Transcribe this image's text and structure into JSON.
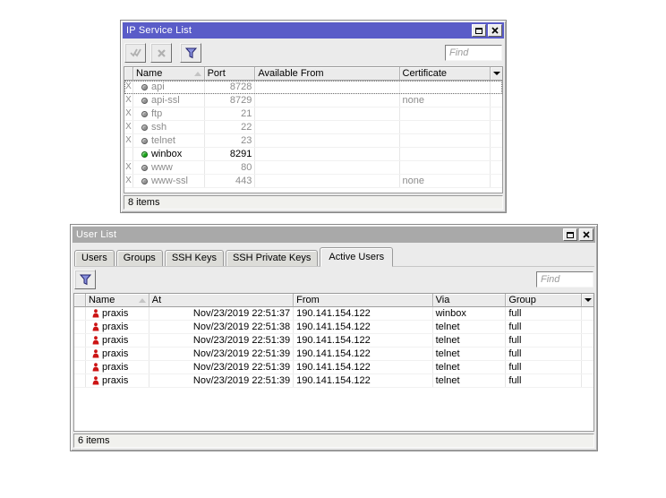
{
  "colors": {
    "active_titlebar": "#5a5cc8",
    "inactive_titlebar": "#a9a9a9",
    "enabled_dot": "#18a818",
    "disabled_dot": "#949494",
    "user_icon": "#cc1414"
  },
  "icons": {
    "disabled_mark": "X"
  },
  "windows": {
    "ip_service": {
      "title": "IP Service List",
      "find_placeholder": "Find",
      "columns": {
        "name": "Name",
        "port": "Port",
        "available_from": "Available From",
        "certificate": "Certificate"
      },
      "rows": [
        {
          "enabled": false,
          "focused": true,
          "name": "api",
          "port": "8728",
          "available_from": "",
          "certificate": ""
        },
        {
          "enabled": false,
          "focused": false,
          "name": "api-ssl",
          "port": "8729",
          "available_from": "",
          "certificate": "none"
        },
        {
          "enabled": false,
          "focused": false,
          "name": "ftp",
          "port": "21",
          "available_from": "",
          "certificate": ""
        },
        {
          "enabled": false,
          "focused": false,
          "name": "ssh",
          "port": "22",
          "available_from": "",
          "certificate": ""
        },
        {
          "enabled": false,
          "focused": false,
          "name": "telnet",
          "port": "23",
          "available_from": "",
          "certificate": ""
        },
        {
          "enabled": true,
          "focused": false,
          "name": "winbox",
          "port": "8291",
          "available_from": "",
          "certificate": ""
        },
        {
          "enabled": false,
          "focused": false,
          "name": "www",
          "port": "80",
          "available_from": "",
          "certificate": ""
        },
        {
          "enabled": false,
          "focused": false,
          "name": "www-ssl",
          "port": "443",
          "available_from": "",
          "certificate": "none"
        }
      ],
      "status": "8 items"
    },
    "user_list": {
      "title": "User List",
      "tabs": [
        {
          "label": "Users"
        },
        {
          "label": "Groups"
        },
        {
          "label": "SSH Keys"
        },
        {
          "label": "SSH Private Keys"
        },
        {
          "label": "Active Users"
        }
      ],
      "active_tab": "Active Users",
      "find_placeholder": "Find",
      "columns": {
        "name": "Name",
        "at": "At",
        "from": "From",
        "via": "Via",
        "group": "Group"
      },
      "rows": [
        {
          "name": "praxis",
          "at": "Nov/23/2019 22:51:37",
          "from": "190.141.154.122",
          "via": "winbox",
          "group": "full"
        },
        {
          "name": "praxis",
          "at": "Nov/23/2019 22:51:38",
          "from": "190.141.154.122",
          "via": "telnet",
          "group": "full"
        },
        {
          "name": "praxis",
          "at": "Nov/23/2019 22:51:39",
          "from": "190.141.154.122",
          "via": "telnet",
          "group": "full"
        },
        {
          "name": "praxis",
          "at": "Nov/23/2019 22:51:39",
          "from": "190.141.154.122",
          "via": "telnet",
          "group": "full"
        },
        {
          "name": "praxis",
          "at": "Nov/23/2019 22:51:39",
          "from": "190.141.154.122",
          "via": "telnet",
          "group": "full"
        },
        {
          "name": "praxis",
          "at": "Nov/23/2019 22:51:39",
          "from": "190.141.154.122",
          "via": "telnet",
          "group": "full"
        }
      ],
      "status": "6 items"
    }
  }
}
